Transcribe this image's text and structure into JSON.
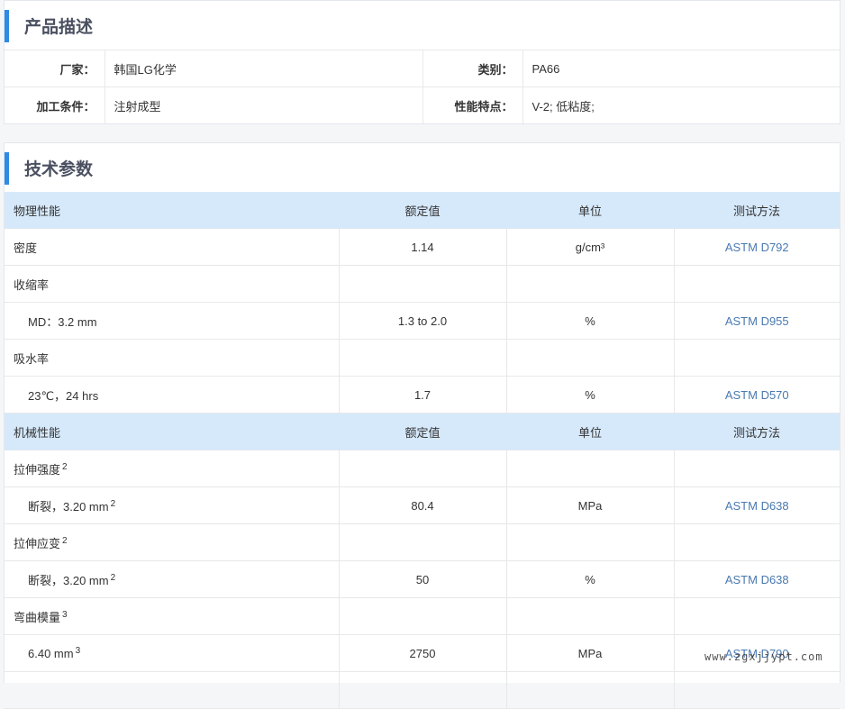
{
  "description": {
    "title": "产品描述",
    "rows": [
      [
        {
          "label": "厂家：",
          "value": "韩国LG化学"
        },
        {
          "label": "类别：",
          "value": "PA66"
        }
      ],
      [
        {
          "label": "加工条件：",
          "value": "注射成型"
        },
        {
          "label": "性能特点：",
          "value": "V-2; 低粘度;"
        }
      ]
    ]
  },
  "tech": {
    "title": "技术参数",
    "rows": [
      {
        "kind": "header",
        "cells": [
          "物理性能",
          "额定值",
          "单位",
          "测试方法"
        ]
      },
      {
        "kind": "item",
        "name": "密度",
        "sup": "",
        "value": "1.14",
        "unit": "g/cm³",
        "method": "ASTM D792"
      },
      {
        "kind": "item",
        "name": "收缩率",
        "sup": "",
        "value": "",
        "unit": "",
        "method": ""
      },
      {
        "kind": "sub",
        "name": "MD：3.2 mm",
        "sup": "",
        "value": "1.3 to 2.0",
        "unit": "%",
        "method": "ASTM D955"
      },
      {
        "kind": "item",
        "name": "吸水率",
        "sup": "",
        "value": "",
        "unit": "",
        "method": ""
      },
      {
        "kind": "sub",
        "name": "23℃，24 hrs",
        "sup": "",
        "value": "1.7",
        "unit": "%",
        "method": "ASTM D570"
      },
      {
        "kind": "header",
        "cells": [
          "机械性能",
          "额定值",
          "单位",
          "测试方法"
        ]
      },
      {
        "kind": "item",
        "name": "拉伸强度",
        "sup": "2",
        "value": "",
        "unit": "",
        "method": ""
      },
      {
        "kind": "sub",
        "name": "断裂，3.20 mm",
        "sup": "2",
        "value": "80.4",
        "unit": "MPa",
        "method": "ASTM D638"
      },
      {
        "kind": "item",
        "name": "拉伸应变",
        "sup": "2",
        "value": "",
        "unit": "",
        "method": ""
      },
      {
        "kind": "sub",
        "name": "断裂，3.20 mm",
        "sup": "2",
        "value": "50",
        "unit": "%",
        "method": "ASTM D638"
      },
      {
        "kind": "item",
        "name": "弯曲模量",
        "sup": "3",
        "value": "",
        "unit": "",
        "method": ""
      },
      {
        "kind": "sub",
        "name": "6.40 mm",
        "sup": "3",
        "value": "2750",
        "unit": "MPa",
        "method": "ASTM D790"
      },
      {
        "kind": "item",
        "name": "",
        "sup": "",
        "value": "",
        "unit": "",
        "method": ""
      }
    ]
  },
  "watermark": "www.zgxjjypt.com"
}
